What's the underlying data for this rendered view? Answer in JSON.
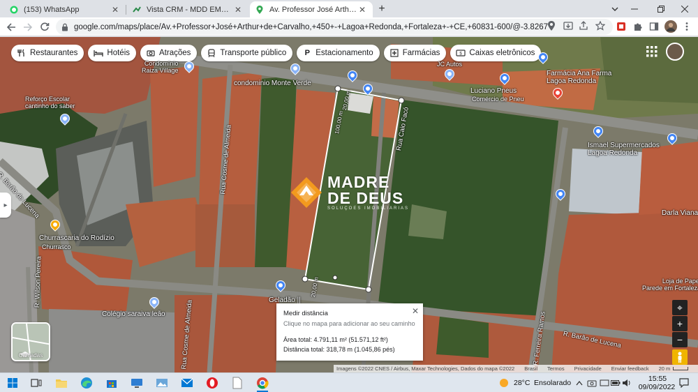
{
  "browser": {
    "tabs": [
      {
        "title": "(153) WhatsApp",
        "icon": "whatsapp-icon",
        "active": false
      },
      {
        "title": "Vista CRM - MDD EMPREENDIMENTOS",
        "icon": "crm-icon",
        "active": false
      },
      {
        "title": "Av. Professor José Arthur de Carvalho",
        "icon": "maps-pin-icon",
        "active": true
      }
    ],
    "url": "google.com/maps/place/Av.+Professor+José+Arthur+de+Carvalho,+450+-+Lagoa+Redonda,+Fortaleza+-+CE,+60831-600/@-3.8267788,-38.475..."
  },
  "maps": {
    "chips": [
      {
        "label": "Restaurantes",
        "icon": "restaurant-icon"
      },
      {
        "label": "Hotéis",
        "icon": "hotel-icon"
      },
      {
        "label": "Atrações",
        "icon": "camera-icon"
      },
      {
        "label": "Transporte público",
        "icon": "transit-icon"
      },
      {
        "label": "Estacionamento",
        "icon": "parking-icon"
      },
      {
        "label": "Farmácias",
        "icon": "pharmacy-icon"
      },
      {
        "label": "Caixas eletrônicos",
        "icon": "atm-icon"
      }
    ],
    "places": {
      "condominio_raiza": "Condomínio\nRaiza Village",
      "condominio_monte_verde": "condominio Monte Verde",
      "reforco_escolar": "Reforço Escolar\ncantinho do saber",
      "jc_autos": "JC Autos",
      "luciano_pneus": "Luciano Pneus",
      "luciano_pneus_sub": "Comércio de Pneu",
      "farmacia": "Farmácia Ana Farma\nLagoa Redonda",
      "ismael": "Ismael Supermercados\nLagoa Redonda",
      "darla": "Darla Viana",
      "loja_papel": "Loja de Papel de\nParede em Fortaleza |...",
      "churrascaria": "Churrascaria do Rodízio",
      "churrascaria_sub": "Churrasco",
      "geladao": "Geladão ||",
      "colegio": "Colégio saraiva leão"
    },
    "streets": {
      "cosme_1": "Rua Cosme de Almeida",
      "cosme_2": "Rua Cosme de Almeida",
      "caio_faco": "Rua Caio Facó",
      "barao_lucena_1": "R. Barão de Lucena",
      "barao_lucena_2": "R. Barão de Lucena",
      "wilson_pereira": "R. Wilson Pereira",
      "ferreira_ramos": "R. Ferreira Ramos"
    },
    "measurement_labels": {
      "top": "20,00 m",
      "left": "100,00 m",
      "bottom": "20,00 m"
    },
    "watermark": {
      "line1": "MADRE",
      "line2": "DE DEUS",
      "line3": "SOLUÇÕES IMOBILIÁRIAS"
    },
    "measure_panel": {
      "title": "Medir distância",
      "hint": "Clique no mapa para adicionar ao seu caminho",
      "area": "Área total: 4.791,11 m² (51.571,12 ft²)",
      "distance": "Distância total: 318,78 m (1.045,86 pés)"
    },
    "layers_label": "Camadas",
    "attribution": {
      "imagery": "Imagens ©2022 CNES / Airbus, Maxar Technologies, Dados do mapa ©2022",
      "country": "Brasil",
      "terms": "Termos",
      "privacy": "Privacidade",
      "feedback": "Enviar feedback",
      "scale": "20 m"
    }
  },
  "taskbar": {
    "weather_temp": "28°C",
    "weather_text": "Ensolarado",
    "time": "15:55",
    "date": "09/09/2022"
  }
}
